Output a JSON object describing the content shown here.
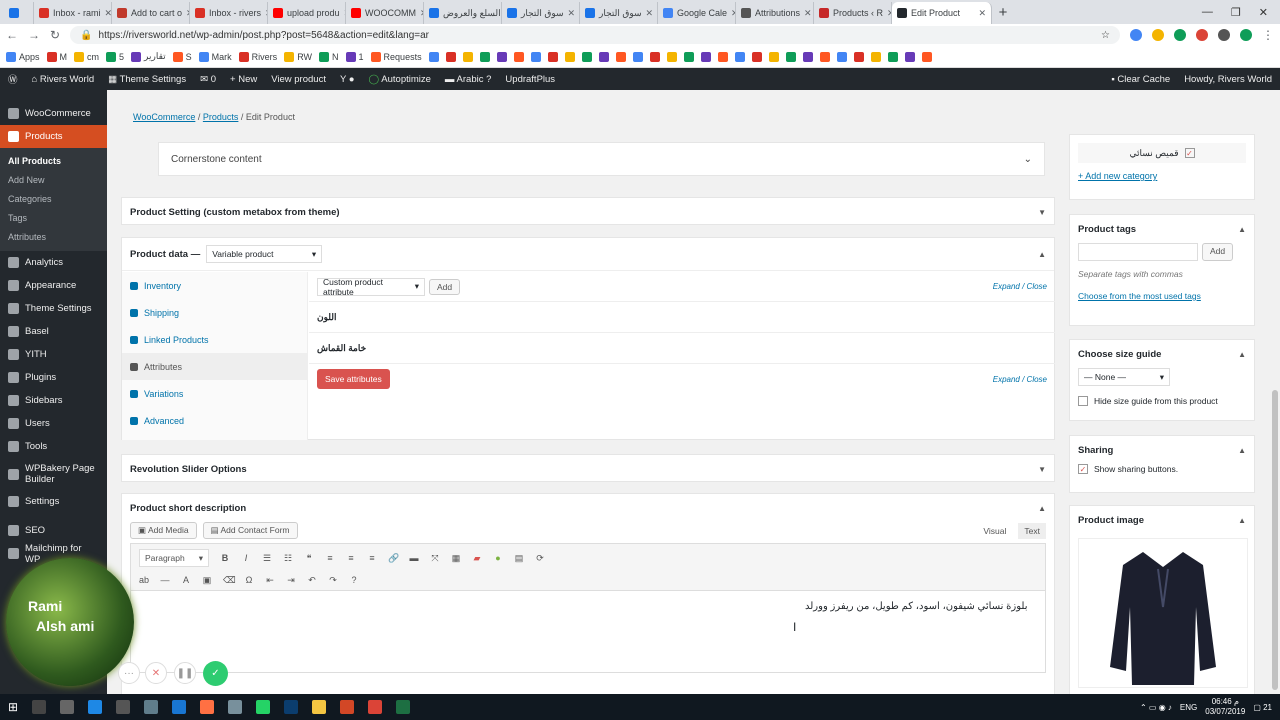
{
  "browser": {
    "tabs": [
      {
        "label": "Inbox - rami",
        "color": "#d93025"
      },
      {
        "label": "Add to cart o",
        "color": "#c0392b"
      },
      {
        "label": "Inbox - rivers",
        "color": "#d93025"
      },
      {
        "label": "upload produ",
        "color": "#ff0000"
      },
      {
        "label": "WOOCOMM",
        "color": "#ff0000"
      },
      {
        "label": "السلع والعروض",
        "color": "#1a73e8"
      },
      {
        "label": "سوق التجار",
        "color": "#1a73e8"
      },
      {
        "label": "سوق التجار",
        "color": "#1a73e8"
      },
      {
        "label": "Google Cale",
        "color": "#4285f4"
      },
      {
        "label": "Attributions",
        "color": "#555555"
      },
      {
        "label": "Products ‹ R",
        "color": "#c62828"
      }
    ],
    "active_tab": "Edit Product",
    "url": "https://riversworld.net/wp-admin/post.php?post=5648&action=edit&lang=ar",
    "bookmarks": [
      "Apps",
      "M",
      "cm",
      "5",
      "تقارير",
      "S",
      "Mark",
      "Rivers",
      "RW",
      "N",
      "1",
      "Requests"
    ]
  },
  "adminbar": {
    "site": "Rivers World",
    "theme_settings": "Theme Settings",
    "comments": "0",
    "new": "New",
    "view_product": "View product",
    "autoptimize": "Autoptimize",
    "language": "Arabic",
    "updraft": "UpdraftPlus",
    "clear_cache": "Clear Cache",
    "howdy": "Howdy, Rivers World"
  },
  "sidebar": {
    "items": [
      {
        "label": "WooCommerce"
      },
      {
        "label": "Products"
      },
      {
        "label": "Analytics"
      },
      {
        "label": "Appearance"
      },
      {
        "label": "Theme Settings"
      },
      {
        "label": "Basel"
      },
      {
        "label": "YITH"
      },
      {
        "label": "Plugins"
      },
      {
        "label": "Sidebars"
      },
      {
        "label": "Users"
      },
      {
        "label": "Tools"
      },
      {
        "label": "WPBakery Page Builder"
      },
      {
        "label": "Settings"
      },
      {
        "label": "SEO"
      },
      {
        "label": "Mailchimp for WP"
      }
    ],
    "products_sub": [
      "All Products",
      "Add New",
      "Categories",
      "Tags",
      "Attributes"
    ]
  },
  "breadcrumb": {
    "root": "WooCommerce",
    "section": "Products",
    "current": "Edit Product"
  },
  "cornerstone": "Cornerstone content",
  "product_setting": "Product Setting (custom metabox from theme)",
  "product_data": {
    "title": "Product data —",
    "type": "Variable product",
    "tabs": [
      "Inventory",
      "Shipping",
      "Linked Products",
      "Attributes",
      "Variations",
      "Advanced"
    ],
    "attr_select": "Custom product attribute",
    "add": "Add",
    "expand_close": "Expand / Close",
    "attributes": [
      "اللون",
      "خامة القماش"
    ],
    "save": "Save attributes"
  },
  "revolution": "Revolution Slider Options",
  "short_desc": {
    "title": "Product short description",
    "add_media": "Add Media",
    "add_contact": "Add Contact Form",
    "visual": "Visual",
    "text": "Text",
    "paragraph": "Paragraph",
    "body": "بلوزة نسائي شيفون، اسود، كم طويل، من ريفرز وورلد"
  },
  "right": {
    "category_item": "قميص نسائي",
    "add_category": "+ Add new category",
    "tags_title": "Product tags",
    "tags_add": "Add",
    "tags_hint": "Separate tags with commas",
    "tags_link": "Choose from the most used tags",
    "size_title": "Choose size guide",
    "size_value": "— None —",
    "size_hide": "Hide size guide from this product",
    "sharing_title": "Sharing",
    "sharing_show": "Show sharing buttons.",
    "image_title": "Product image"
  },
  "overlay": {
    "line1": "Rami",
    "line2": "Alsh ami"
  },
  "taskbar": {
    "lang": "ENG",
    "time": "06:46 م",
    "date": "03/07/2019",
    "count": "21"
  }
}
